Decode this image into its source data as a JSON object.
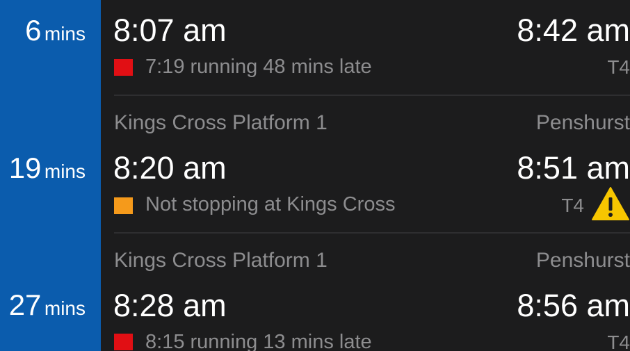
{
  "trips": [
    {
      "minutes": "6",
      "minutes_unit": "mins",
      "platform": "",
      "destination": "",
      "depart_time": "8:07 am",
      "arrive_time": "8:42 am",
      "status_text": "7:19 running 48 mins late",
      "status_color": "#e10f14",
      "line": "T4",
      "warning": false
    },
    {
      "minutes": "19",
      "minutes_unit": "mins",
      "platform": "Kings Cross Platform 1",
      "destination": "Penshurst",
      "depart_time": "8:20 am",
      "arrive_time": "8:51 am",
      "status_text": "Not stopping at Kings Cross",
      "status_color": "#f59a1b",
      "line": "T4",
      "warning": true
    },
    {
      "minutes": "27",
      "minutes_unit": "mins",
      "platform": "Kings Cross Platform 1",
      "destination": "Penshurst",
      "depart_time": "8:28 am",
      "arrive_time": "8:56 am",
      "status_text": "8:15 running 13 mins late",
      "status_color": "#e10f14",
      "line": "T4",
      "warning": false
    }
  ],
  "colors": {
    "sidebar_blue": "#0b5cad",
    "background": "#1c1c1d",
    "warning_yellow": "#f7c600"
  },
  "icons": {
    "warning": "warning-triangle-icon"
  }
}
